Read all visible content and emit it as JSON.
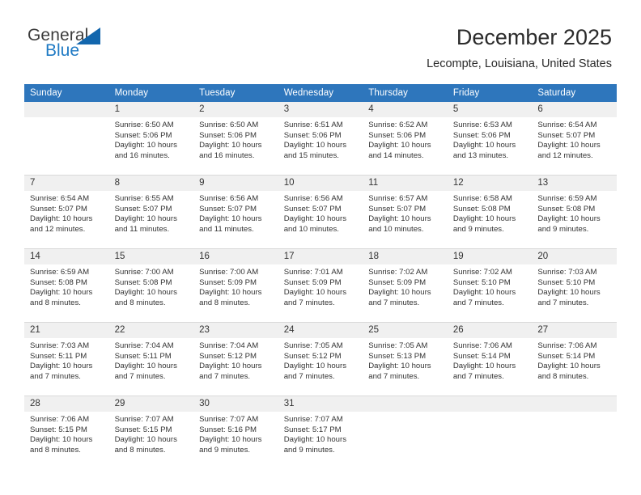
{
  "brand": {
    "name_part1": "General",
    "name_part2": "Blue",
    "triangle_color": "#1266ad",
    "blue_color": "#1f7ac4"
  },
  "header": {
    "title": "December 2025",
    "subtitle": "Lecompte, Louisiana, United States"
  },
  "theme": {
    "header_row_bg": "#2e76bc",
    "daynum_bg": "#f0f0f0",
    "grid_line": "#d9d9d9"
  },
  "weekdays": [
    "Sunday",
    "Monday",
    "Tuesday",
    "Wednesday",
    "Thursday",
    "Friday",
    "Saturday"
  ],
  "labels": {
    "sunrise_prefix": "Sunrise:",
    "sunset_prefix": "Sunset:",
    "daylight_prefix": "Daylight:"
  },
  "weeks": [
    [
      {
        "day": "",
        "sunrise": "",
        "sunset": "",
        "daylight_line1": "",
        "daylight_line2": ""
      },
      {
        "day": "1",
        "sunrise": "Sunrise: 6:50 AM",
        "sunset": "Sunset: 5:06 PM",
        "daylight_line1": "Daylight: 10 hours",
        "daylight_line2": "and 16 minutes."
      },
      {
        "day": "2",
        "sunrise": "Sunrise: 6:50 AM",
        "sunset": "Sunset: 5:06 PM",
        "daylight_line1": "Daylight: 10 hours",
        "daylight_line2": "and 16 minutes."
      },
      {
        "day": "3",
        "sunrise": "Sunrise: 6:51 AM",
        "sunset": "Sunset: 5:06 PM",
        "daylight_line1": "Daylight: 10 hours",
        "daylight_line2": "and 15 minutes."
      },
      {
        "day": "4",
        "sunrise": "Sunrise: 6:52 AM",
        "sunset": "Sunset: 5:06 PM",
        "daylight_line1": "Daylight: 10 hours",
        "daylight_line2": "and 14 minutes."
      },
      {
        "day": "5",
        "sunrise": "Sunrise: 6:53 AM",
        "sunset": "Sunset: 5:06 PM",
        "daylight_line1": "Daylight: 10 hours",
        "daylight_line2": "and 13 minutes."
      },
      {
        "day": "6",
        "sunrise": "Sunrise: 6:54 AM",
        "sunset": "Sunset: 5:07 PM",
        "daylight_line1": "Daylight: 10 hours",
        "daylight_line2": "and 12 minutes."
      }
    ],
    [
      {
        "day": "7",
        "sunrise": "Sunrise: 6:54 AM",
        "sunset": "Sunset: 5:07 PM",
        "daylight_line1": "Daylight: 10 hours",
        "daylight_line2": "and 12 minutes."
      },
      {
        "day": "8",
        "sunrise": "Sunrise: 6:55 AM",
        "sunset": "Sunset: 5:07 PM",
        "daylight_line1": "Daylight: 10 hours",
        "daylight_line2": "and 11 minutes."
      },
      {
        "day": "9",
        "sunrise": "Sunrise: 6:56 AM",
        "sunset": "Sunset: 5:07 PM",
        "daylight_line1": "Daylight: 10 hours",
        "daylight_line2": "and 11 minutes."
      },
      {
        "day": "10",
        "sunrise": "Sunrise: 6:56 AM",
        "sunset": "Sunset: 5:07 PM",
        "daylight_line1": "Daylight: 10 hours",
        "daylight_line2": "and 10 minutes."
      },
      {
        "day": "11",
        "sunrise": "Sunrise: 6:57 AM",
        "sunset": "Sunset: 5:07 PM",
        "daylight_line1": "Daylight: 10 hours",
        "daylight_line2": "and 10 minutes."
      },
      {
        "day": "12",
        "sunrise": "Sunrise: 6:58 AM",
        "sunset": "Sunset: 5:08 PM",
        "daylight_line1": "Daylight: 10 hours",
        "daylight_line2": "and 9 minutes."
      },
      {
        "day": "13",
        "sunrise": "Sunrise: 6:59 AM",
        "sunset": "Sunset: 5:08 PM",
        "daylight_line1": "Daylight: 10 hours",
        "daylight_line2": "and 9 minutes."
      }
    ],
    [
      {
        "day": "14",
        "sunrise": "Sunrise: 6:59 AM",
        "sunset": "Sunset: 5:08 PM",
        "daylight_line1": "Daylight: 10 hours",
        "daylight_line2": "and 8 minutes."
      },
      {
        "day": "15",
        "sunrise": "Sunrise: 7:00 AM",
        "sunset": "Sunset: 5:08 PM",
        "daylight_line1": "Daylight: 10 hours",
        "daylight_line2": "and 8 minutes."
      },
      {
        "day": "16",
        "sunrise": "Sunrise: 7:00 AM",
        "sunset": "Sunset: 5:09 PM",
        "daylight_line1": "Daylight: 10 hours",
        "daylight_line2": "and 8 minutes."
      },
      {
        "day": "17",
        "sunrise": "Sunrise: 7:01 AM",
        "sunset": "Sunset: 5:09 PM",
        "daylight_line1": "Daylight: 10 hours",
        "daylight_line2": "and 7 minutes."
      },
      {
        "day": "18",
        "sunrise": "Sunrise: 7:02 AM",
        "sunset": "Sunset: 5:09 PM",
        "daylight_line1": "Daylight: 10 hours",
        "daylight_line2": "and 7 minutes."
      },
      {
        "day": "19",
        "sunrise": "Sunrise: 7:02 AM",
        "sunset": "Sunset: 5:10 PM",
        "daylight_line1": "Daylight: 10 hours",
        "daylight_line2": "and 7 minutes."
      },
      {
        "day": "20",
        "sunrise": "Sunrise: 7:03 AM",
        "sunset": "Sunset: 5:10 PM",
        "daylight_line1": "Daylight: 10 hours",
        "daylight_line2": "and 7 minutes."
      }
    ],
    [
      {
        "day": "21",
        "sunrise": "Sunrise: 7:03 AM",
        "sunset": "Sunset: 5:11 PM",
        "daylight_line1": "Daylight: 10 hours",
        "daylight_line2": "and 7 minutes."
      },
      {
        "day": "22",
        "sunrise": "Sunrise: 7:04 AM",
        "sunset": "Sunset: 5:11 PM",
        "daylight_line1": "Daylight: 10 hours",
        "daylight_line2": "and 7 minutes."
      },
      {
        "day": "23",
        "sunrise": "Sunrise: 7:04 AM",
        "sunset": "Sunset: 5:12 PM",
        "daylight_line1": "Daylight: 10 hours",
        "daylight_line2": "and 7 minutes."
      },
      {
        "day": "24",
        "sunrise": "Sunrise: 7:05 AM",
        "sunset": "Sunset: 5:12 PM",
        "daylight_line1": "Daylight: 10 hours",
        "daylight_line2": "and 7 minutes."
      },
      {
        "day": "25",
        "sunrise": "Sunrise: 7:05 AM",
        "sunset": "Sunset: 5:13 PM",
        "daylight_line1": "Daylight: 10 hours",
        "daylight_line2": "and 7 minutes."
      },
      {
        "day": "26",
        "sunrise": "Sunrise: 7:06 AM",
        "sunset": "Sunset: 5:14 PM",
        "daylight_line1": "Daylight: 10 hours",
        "daylight_line2": "and 7 minutes."
      },
      {
        "day": "27",
        "sunrise": "Sunrise: 7:06 AM",
        "sunset": "Sunset: 5:14 PM",
        "daylight_line1": "Daylight: 10 hours",
        "daylight_line2": "and 8 minutes."
      }
    ],
    [
      {
        "day": "28",
        "sunrise": "Sunrise: 7:06 AM",
        "sunset": "Sunset: 5:15 PM",
        "daylight_line1": "Daylight: 10 hours",
        "daylight_line2": "and 8 minutes."
      },
      {
        "day": "29",
        "sunrise": "Sunrise: 7:07 AM",
        "sunset": "Sunset: 5:15 PM",
        "daylight_line1": "Daylight: 10 hours",
        "daylight_line2": "and 8 minutes."
      },
      {
        "day": "30",
        "sunrise": "Sunrise: 7:07 AM",
        "sunset": "Sunset: 5:16 PM",
        "daylight_line1": "Daylight: 10 hours",
        "daylight_line2": "and 9 minutes."
      },
      {
        "day": "31",
        "sunrise": "Sunrise: 7:07 AM",
        "sunset": "Sunset: 5:17 PM",
        "daylight_line1": "Daylight: 10 hours",
        "daylight_line2": "and 9 minutes."
      },
      {
        "day": "",
        "sunrise": "",
        "sunset": "",
        "daylight_line1": "",
        "daylight_line2": ""
      },
      {
        "day": "",
        "sunrise": "",
        "sunset": "",
        "daylight_line1": "",
        "daylight_line2": ""
      },
      {
        "day": "",
        "sunrise": "",
        "sunset": "",
        "daylight_line1": "",
        "daylight_line2": ""
      }
    ]
  ]
}
